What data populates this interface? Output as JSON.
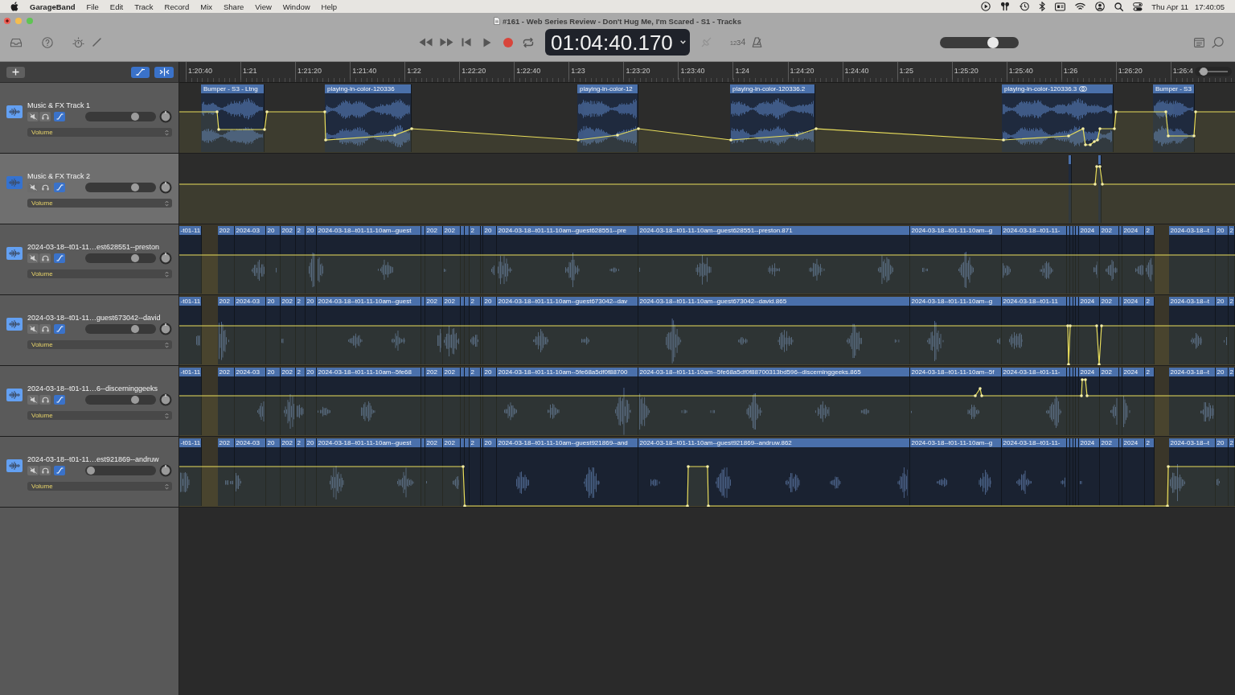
{
  "menu_bar": {
    "app_name": "GarageBand",
    "menus": [
      "File",
      "Edit",
      "Track",
      "Record",
      "Mix",
      "Share",
      "View",
      "Window",
      "Help"
    ],
    "date": "Thu Apr 11",
    "time": "17:40:05"
  },
  "window": {
    "title": "#161 - Web Series Review - Don't Hug Me, I'm Scared - S1 - Tracks",
    "unsaved_changes": true
  },
  "toolbar": {
    "cycle": {
      "on": false
    },
    "lcd_time": "01:04:40.170",
    "tuner": {
      "disabled": true
    },
    "count_in": {
      "label": "1234",
      "on": false
    },
    "metronome": {
      "on": false
    },
    "master_volume": {
      "level": 0.7
    }
  },
  "tracks_header": {
    "automation_button": {
      "on": true
    },
    "catch_button": {
      "on": true
    }
  },
  "ruler": {
    "labels": [
      "1:20:40",
      "1:21",
      "1:21:20",
      "1:21:40",
      "1:22",
      "1:22:20",
      "1:22:40",
      "1:23",
      "1:23:20",
      "1:23:40",
      "1:24",
      "1:24:20",
      "1:24:40",
      "1:25",
      "1:25:20",
      "1:25:40",
      "1:26",
      "1:26:20",
      "1:26:4"
    ],
    "zoom_slider": {
      "level": 0.17
    }
  },
  "tracks": [
    {
      "name": "Music & FX Track 1",
      "kind": "music",
      "selected": false,
      "muted": false,
      "soloed": false,
      "automation": true,
      "level": 0.73,
      "automation_parameter": "Volume",
      "regions": [
        {
          "label": "Bumper - S3 - Ltng",
          "looped": false
        },
        {
          "label": "playing-in-color-120336",
          "looped": false
        },
        {
          "label": "playing-in-color-12",
          "looped": false
        },
        {
          "label": "playing-in-color-120336.2",
          "looped": false
        },
        {
          "label": "playing-in-color-120336.3",
          "looped": true
        },
        {
          "label": "Bumper - S3",
          "looped": false
        }
      ]
    },
    {
      "name": "Music & FX Track 2",
      "kind": "music",
      "selected": true,
      "muted": false,
      "soloed": false,
      "automation": true,
      "level": 0.73,
      "automation_parameter": "Volume"
    },
    {
      "name": "2024-03-18--t01-11…est628551--preston",
      "kind": "voice",
      "selected": false,
      "muted": false,
      "soloed": false,
      "automation": true,
      "level": 0.73,
      "automation_parameter": "Volume",
      "regions": [
        {
          "label": "-t01-11"
        },
        {
          "label": "202"
        },
        {
          "label": "2024-03"
        },
        {
          "label": "20"
        },
        {
          "label": "202"
        },
        {
          "label": "2"
        },
        {
          "label": "20"
        },
        {
          "label": "2024-03-18--t01-11-10am--guest"
        },
        {
          "label": "202"
        },
        {
          "label": "202"
        },
        {
          "label": "2"
        },
        {
          "label": "20"
        },
        {
          "label": "2024-03-18--t01-11-10am--guest628551--pre"
        },
        {
          "label": "2024-03-18--t01-11-10am--guest628551--preston.871"
        },
        {
          "label": "2024-03-18--t01-11-10am--g"
        },
        {
          "label": "2024-03-18--t01-11-"
        },
        {
          "label": "2024"
        },
        {
          "label": "202"
        },
        {
          "label": "2024"
        },
        {
          "label": "2"
        },
        {
          "label": "2024-03-18--t"
        },
        {
          "label": "20"
        },
        {
          "label": "2"
        }
      ]
    },
    {
      "name": "2024-03-18--t01-11…guest673042--david",
      "kind": "voice",
      "selected": false,
      "muted": false,
      "soloed": false,
      "automation": true,
      "level": 0.73,
      "automation_parameter": "Volume",
      "regions": [
        {
          "label": "-t01-11"
        },
        {
          "label": "202"
        },
        {
          "label": "2024-03"
        },
        {
          "label": "20"
        },
        {
          "label": "202"
        },
        {
          "label": "2"
        },
        {
          "label": "20"
        },
        {
          "label": "2024-03-18--t01-11-10am--guest"
        },
        {
          "label": "202"
        },
        {
          "label": "202"
        },
        {
          "label": "2"
        },
        {
          "label": "20"
        },
        {
          "label": "2024-03-18--t01-11-10am--guest673042--dav"
        },
        {
          "label": "2024-03-18--t01-11-10am--guest673042--david.865"
        },
        {
          "label": "2024-03-18--t01-11-10am--g"
        },
        {
          "label": "2024-03-18--t01-11"
        },
        {
          "label": "2024"
        },
        {
          "label": "202"
        },
        {
          "label": "2024"
        },
        {
          "label": "2"
        },
        {
          "label": "2024-03-18--t"
        },
        {
          "label": "20"
        },
        {
          "label": "2"
        }
      ]
    },
    {
      "name": "2024-03-18--t01-11…6--discerninggeeks",
      "kind": "voice",
      "selected": false,
      "muted": false,
      "soloed": false,
      "automation": true,
      "level": 0.73,
      "automation_parameter": "Volume",
      "regions": [
        {
          "label": "-t01-11"
        },
        {
          "label": "202"
        },
        {
          "label": "2024-03"
        },
        {
          "label": "20"
        },
        {
          "label": "202"
        },
        {
          "label": "2"
        },
        {
          "label": "20"
        },
        {
          "label": "2024-03-18--t01-11-10am--5fe68"
        },
        {
          "label": "202"
        },
        {
          "label": "202"
        },
        {
          "label": "2"
        },
        {
          "label": "20"
        },
        {
          "label": "2024-03-18--t01-11-10am--5fe68a5df0f88700"
        },
        {
          "label": "2024-03-18--t01-11-10am--5fe68a5df0f88700313bd596--discerninggeeks.865"
        },
        {
          "label": "2024-03-18--t01-11-10am--5f"
        },
        {
          "label": "2024-03-18--t01-11-"
        },
        {
          "label": "2024"
        },
        {
          "label": "202"
        },
        {
          "label": "2024"
        },
        {
          "label": "2"
        },
        {
          "label": "2024-03-18--t"
        },
        {
          "label": "20"
        },
        {
          "label": "2"
        }
      ]
    },
    {
      "name": "2024-03-18--t01-11…est921869--andruw",
      "kind": "voice",
      "selected": false,
      "muted": false,
      "soloed": false,
      "automation": true,
      "level": 0.02,
      "automation_parameter": "Volume",
      "regions": [
        {
          "label": "-t01-11"
        },
        {
          "label": "202"
        },
        {
          "label": "2024-03"
        },
        {
          "label": "20"
        },
        {
          "label": "202"
        },
        {
          "label": "2"
        },
        {
          "label": "20"
        },
        {
          "label": "2024-03-18--t01-11-10am--guest"
        },
        {
          "label": "202"
        },
        {
          "label": "202"
        },
        {
          "label": "2"
        },
        {
          "label": "20"
        },
        {
          "label": "2024-03-18--t01-11-10am--guest921869--and"
        },
        {
          "label": "2024-03-18--t01-11-10am--guest921869--andruw.862"
        },
        {
          "label": "2024-03-18--t01-11-10am--g"
        },
        {
          "label": "2024-03-18--t01-11-"
        },
        {
          "label": "2024"
        },
        {
          "label": "202"
        },
        {
          "label": "2024"
        },
        {
          "label": "2"
        },
        {
          "label": "2024-03-18--t"
        },
        {
          "label": "20"
        },
        {
          "label": "2"
        }
      ]
    }
  ]
}
